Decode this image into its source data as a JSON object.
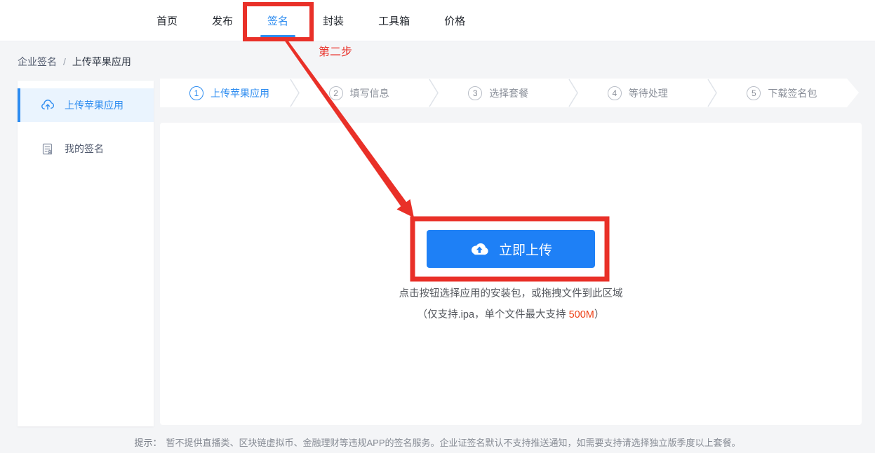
{
  "nav": {
    "items": [
      {
        "label": "首页",
        "active": false
      },
      {
        "label": "发布",
        "active": false
      },
      {
        "label": "签名",
        "active": true
      },
      {
        "label": "封装",
        "active": false
      },
      {
        "label": "工具箱",
        "active": false
      },
      {
        "label": "价格",
        "active": false
      }
    ]
  },
  "breadcrumb": {
    "items": [
      "企业签名",
      "上传苹果应用"
    ],
    "separator": "/"
  },
  "sidebar": {
    "items": [
      {
        "label": "上传苹果应用",
        "icon": "cloud-upload-icon",
        "active": true
      },
      {
        "label": "我的签名",
        "icon": "signature-file-icon",
        "active": false
      }
    ]
  },
  "steps": [
    {
      "num": "1",
      "label": "上传苹果应用",
      "active": true
    },
    {
      "num": "2",
      "label": "填写信息",
      "active": false
    },
    {
      "num": "3",
      "label": "选择套餐",
      "active": false
    },
    {
      "num": "4",
      "label": "等待处理",
      "active": false
    },
    {
      "num": "5",
      "label": "下载签名包",
      "active": false
    }
  ],
  "upload": {
    "button_label": "立即上传",
    "button_icon": "cloud-upload-icon",
    "hint_line1": "点击按钮选择应用的安装包，或拖拽文件到此区域",
    "hint_line2_prefix": "（仅支持.ipa，单个文件最大支持 ",
    "hint_size_limit": "500M",
    "hint_line2_suffix": "）"
  },
  "footer": {
    "tip_label": "提示：",
    "tip_text": "暂不提供直播类、区块链虚拟币、金融理财等违规APP的签名服务。企业证签名默认不支持推送通知，如需要支持请选择独立版季度以上套餐。"
  },
  "annotations": {
    "step_note": "第二步"
  },
  "colors": {
    "accent_blue": "#2d8cf0",
    "button_blue": "#1e80f6",
    "annotation_red": "#e93028",
    "limit_red": "#ed3f14",
    "page_bg": "#f4f5f7",
    "sidebar_active_bg": "#eaf4fe"
  }
}
